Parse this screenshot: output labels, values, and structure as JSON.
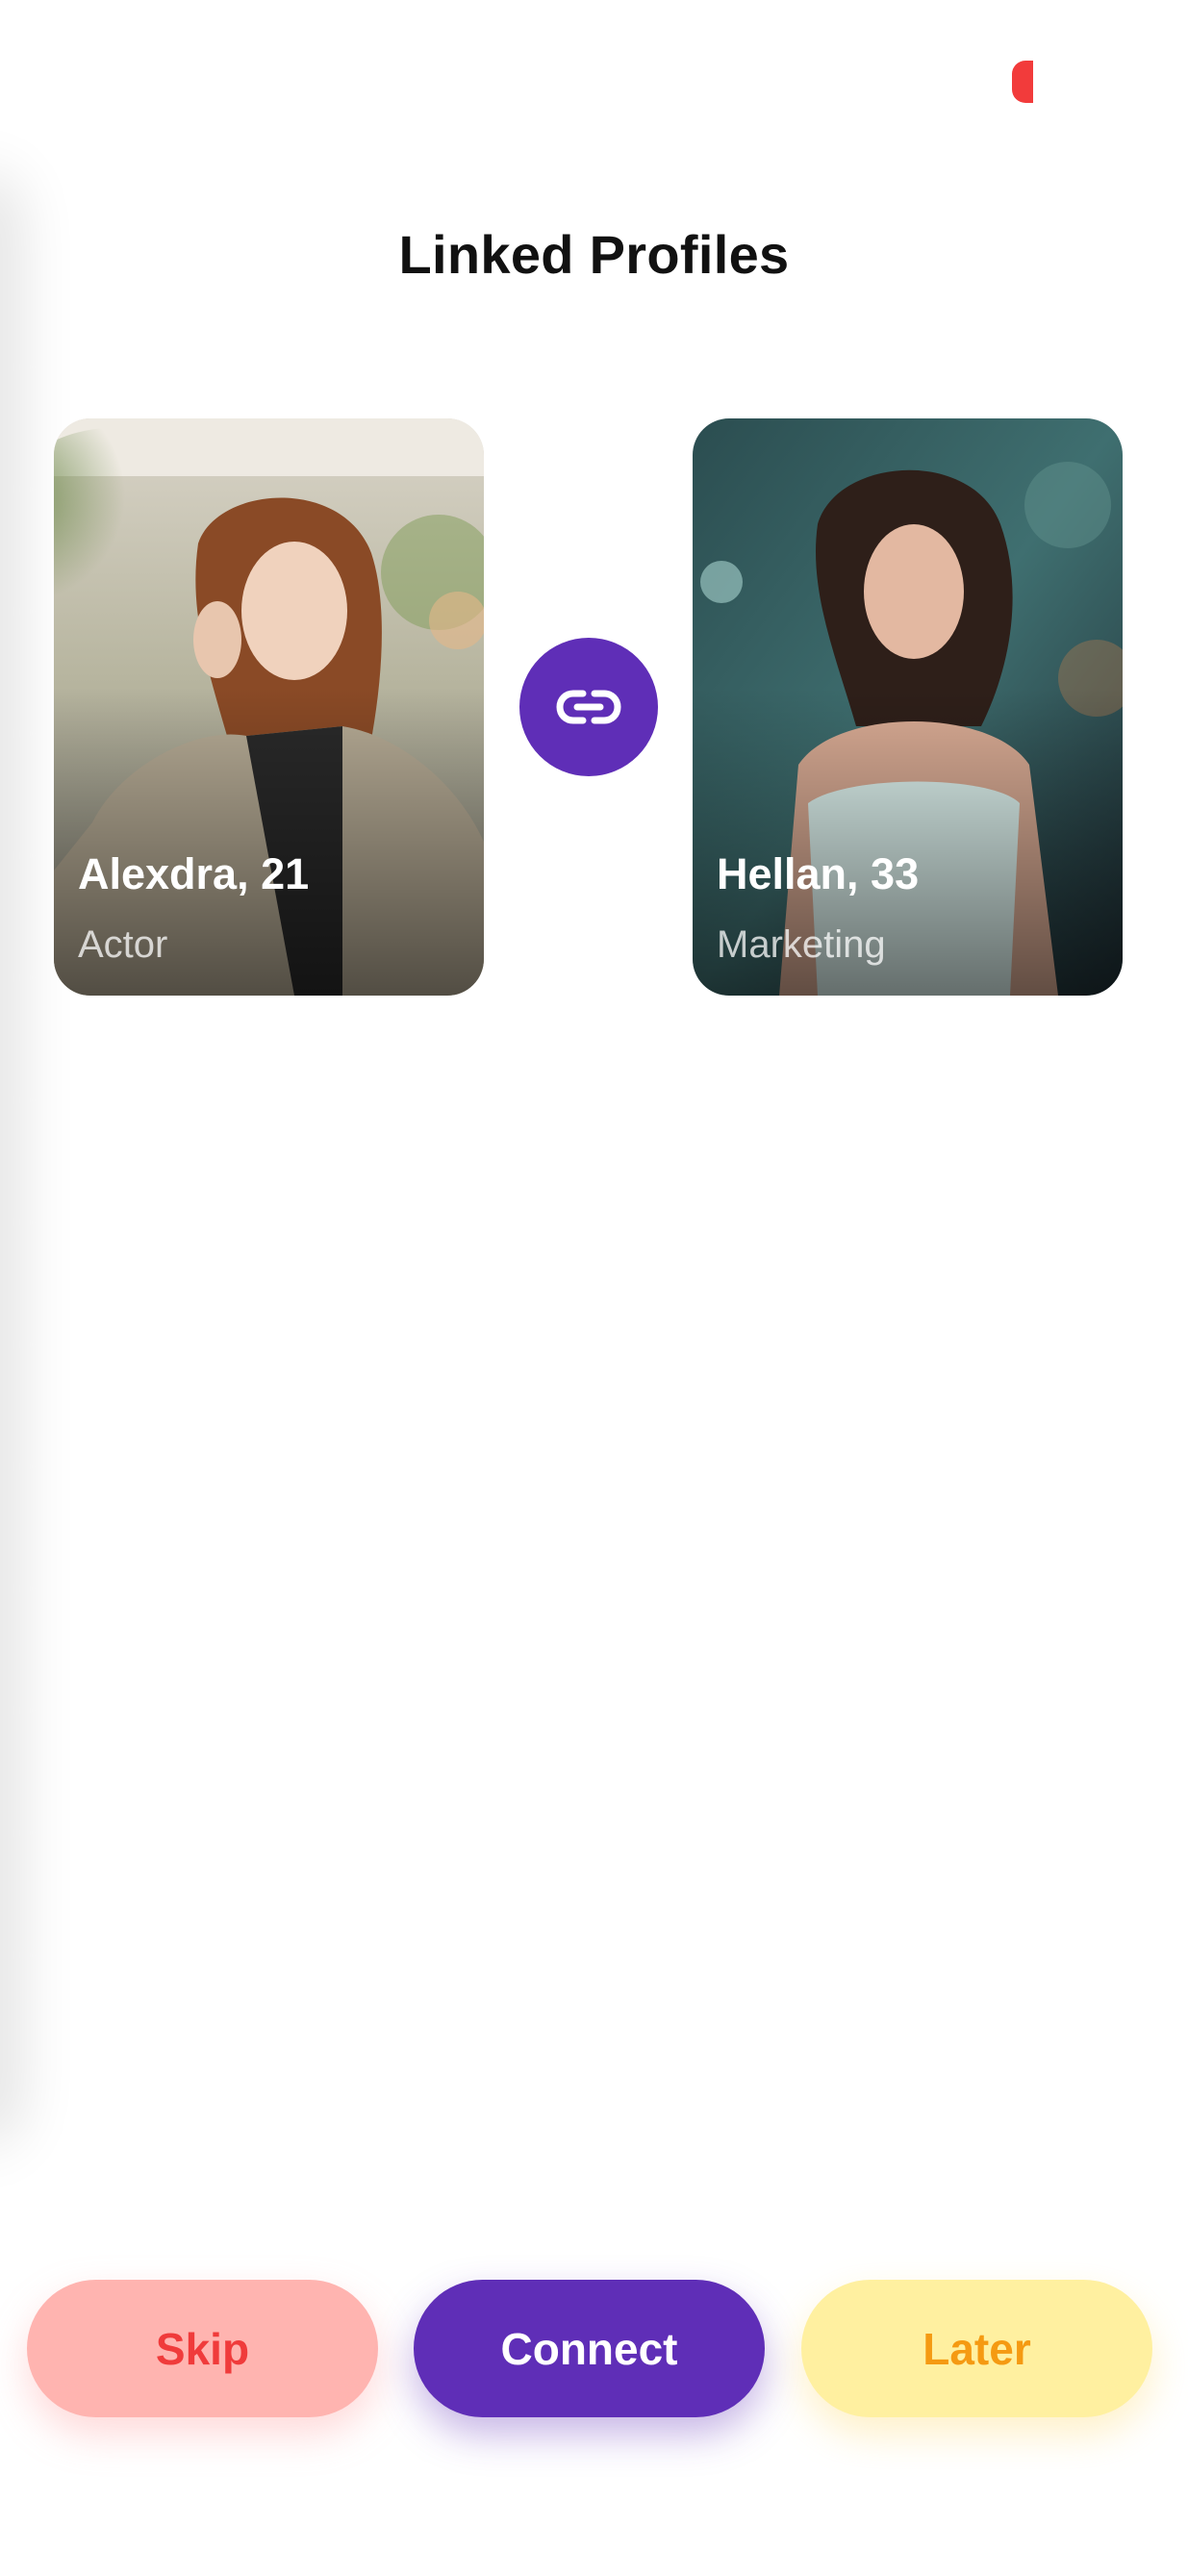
{
  "header": {
    "title": "Linked Profiles"
  },
  "profiles": [
    {
      "name_age": "Alexdra, 21",
      "role": "Actor"
    },
    {
      "name_age": "Hellan, 33",
      "role": "Marketing"
    }
  ],
  "link_icon": "link-icon",
  "actions": {
    "skip_label": "Skip",
    "connect_label": "Connect",
    "later_label": "Later"
  },
  "colors": {
    "primary": "#5f2eb7",
    "skip_bg": "#ffb4b0",
    "skip_text": "#f03b3b",
    "later_bg": "#fff0a0",
    "later_text": "#f59a12",
    "status_indicator": "#f23b3b"
  }
}
